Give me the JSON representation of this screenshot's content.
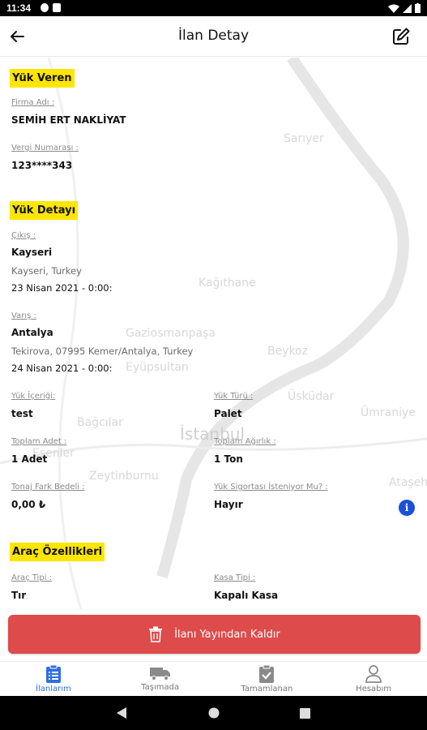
{
  "status_bar": {
    "time": "11:34"
  },
  "app_bar": {
    "title": "İlan Detay",
    "back_icon": "arrow-left-icon",
    "edit_icon": "edit-icon"
  },
  "map_labels": [
    "Sarıyer",
    "Kağıthane",
    "Gaziosmanpaşa",
    "Eyüpsultan",
    "Beykoz",
    "Ümraniye",
    "Bağcılar",
    "İstanbul",
    "Esenler",
    "Zeytinburnu",
    "Ataşehir",
    "Üsküdar"
  ],
  "yuk_veren": {
    "title": "Yük Veren",
    "firma_label": "Firma Adı :",
    "firma_value": "SEMİH ERT NAKLİYAT",
    "vergi_label": "Vergi Numarası :",
    "vergi_value": "123****343"
  },
  "yuk_detayi": {
    "title": "Yük Detayı",
    "cikis_label": "Çıkış :",
    "cikis_city": "Kayseri",
    "cikis_address": "Kayseri, Turkey",
    "cikis_date": "23 Nisan 2021 - 0:00:",
    "varis_label": "Varış :",
    "varis_city": "Antalya",
    "varis_address": "Tekirova, 07995 Kemer/Antalya, Turkey",
    "varis_date": "24 Nisan 2021 - 0:00:",
    "icerik_label": "Yük İçeriği:",
    "icerik_value": "test",
    "tur_label": "Yük Türü :",
    "tur_value": "Palet",
    "adet_label": "Toplam Adet :",
    "adet_value": "1 Adet",
    "agirlik_label": "Toplam Ağırlık :",
    "agirlik_value": "1 Ton",
    "tonaj_label": "Tonaj Fark Bedeli :",
    "tonaj_value": "0,00 ₺",
    "sigorta_label": "Yük Sigortası İsteniyor Mu? :",
    "sigorta_value": "Hayır",
    "info_icon": "info-icon"
  },
  "arac": {
    "title": "Araç Özellikleri",
    "tip_label": "Araç Tipi :",
    "tip_value": "Tır",
    "kasa_label": "Kasa Tipi :",
    "kasa_value": "Kapalı Kasa"
  },
  "remove_button": {
    "label": "İlanı Yayından Kaldır",
    "icon": "trash-icon"
  },
  "bottom_nav": [
    {
      "label": "İlanlarım",
      "icon": "clipboard-list-icon",
      "active": true
    },
    {
      "label": "Taşımada",
      "icon": "truck-icon",
      "active": false
    },
    {
      "label": "Tamamlanan",
      "icon": "clipboard-check-icon",
      "active": false
    },
    {
      "label": "Hesabım",
      "icon": "user-icon",
      "active": false
    }
  ],
  "colors": {
    "highlight": "#ffe600",
    "danger": "#de4b4b",
    "accent": "#2e6ee6",
    "info": "#1a4fd8"
  }
}
